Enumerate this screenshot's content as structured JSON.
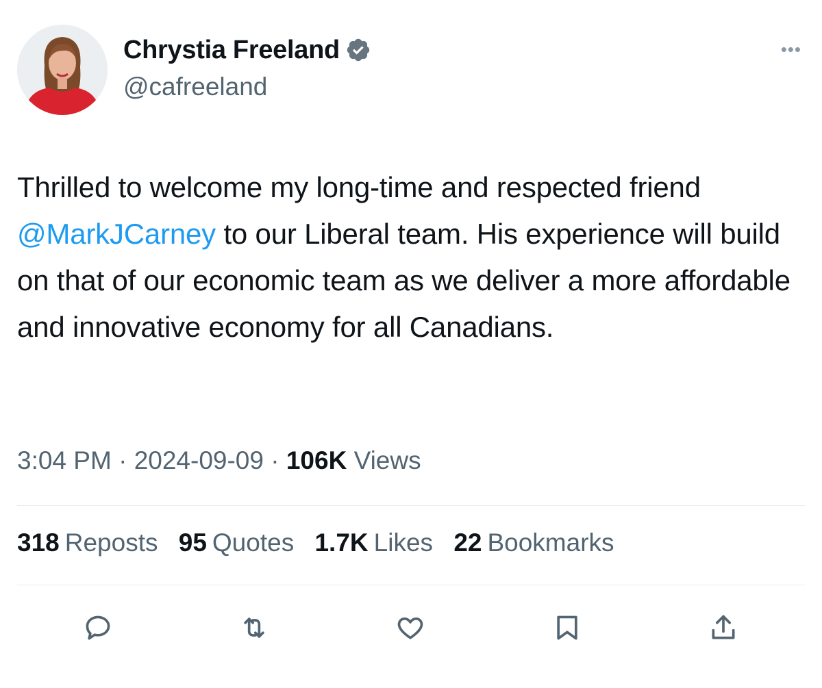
{
  "author": {
    "display_name": "Chrystia Freeland",
    "handle": "@cafreeland",
    "verified": true,
    "verified_color": "#66757f"
  },
  "tweet": {
    "text_before_mention": "Thrilled to welcome my long-time and respected friend ",
    "mention": "@MarkJCarney",
    "text_after_mention": " to our Liberal team. His experience will build on that of our economic team as we deliver a more affordable and innovative economy for all Canadians.",
    "mention_color": "#1d9bf0"
  },
  "meta": {
    "time": "3:04 PM",
    "separator": "·",
    "date": "2024-09-09",
    "views_count": "106K",
    "views_label": "Views"
  },
  "stats": [
    {
      "count": "318",
      "label": "Reposts"
    },
    {
      "count": "95",
      "label": "Quotes"
    },
    {
      "count": "1.7K",
      "label": "Likes"
    },
    {
      "count": "22",
      "label": "Bookmarks"
    }
  ],
  "actions": [
    "reply-icon",
    "repost-icon",
    "like-icon",
    "bookmark-icon",
    "share-icon"
  ],
  "icon_color": "#536471"
}
